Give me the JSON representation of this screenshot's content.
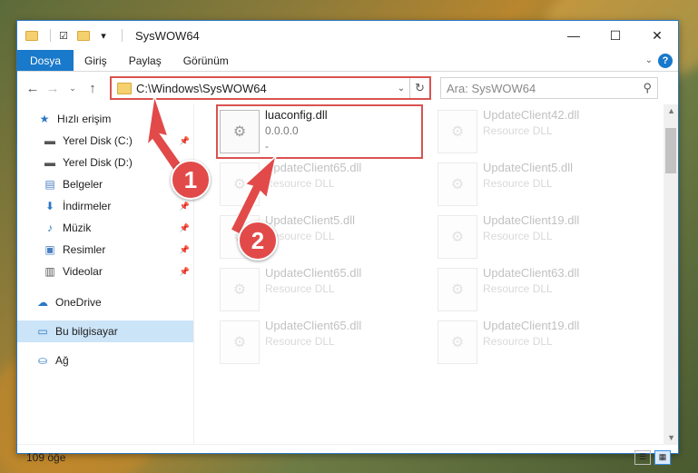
{
  "window": {
    "title": "SysWOW64"
  },
  "ribbon": {
    "tabs": [
      "Dosya",
      "Giriş",
      "Paylaş",
      "Görünüm"
    ]
  },
  "nav": {
    "address": "C:\\Windows\\SysWOW64",
    "search_placeholder": "Ara: SysWOW64"
  },
  "sidebar": {
    "items": [
      {
        "label": "Hızlı erişim",
        "icon": "star-icon"
      },
      {
        "label": "Yerel Disk (C:)",
        "icon": "drive-icon",
        "pinned": true
      },
      {
        "label": "Yerel Disk (D:)",
        "icon": "drive-icon"
      },
      {
        "label": "Belgeler",
        "icon": "documents-icon",
        "pinned": true
      },
      {
        "label": "İndirmeler",
        "icon": "download-icon",
        "pinned": true
      },
      {
        "label": "Müzik",
        "icon": "music-icon",
        "pinned": true
      },
      {
        "label": "Resimler",
        "icon": "pictures-icon",
        "pinned": true
      },
      {
        "label": "Videolar",
        "icon": "videos-icon",
        "pinned": true
      },
      {
        "label": "OneDrive",
        "icon": "cloud-icon"
      },
      {
        "label": "Bu bilgisayar",
        "icon": "computer-icon",
        "selected": true
      },
      {
        "label": "Ağ",
        "icon": "network-icon"
      }
    ]
  },
  "files": {
    "primary": {
      "name": "luaconfig.dll",
      "version": "0.0.0.0",
      "extra": "-"
    },
    "faded": [
      {
        "name": "UpdateClient42.dll",
        "type": "Resource DLL"
      },
      {
        "name": "UpdateClient65.dll",
        "type": "Resource DLL"
      },
      {
        "name": "UpdateClient5.dll",
        "type": "Resource DLL"
      },
      {
        "name": "UpdateClient5.dll",
        "type": "Resource DLL"
      },
      {
        "name": "UpdateClient19.dll",
        "type": "Resource DLL"
      },
      {
        "name": "UpdateClient65.dll",
        "type": "Resource DLL"
      },
      {
        "name": "UpdateClient63.dll",
        "type": "Resource DLL"
      },
      {
        "name": "UpdateClient65.dll",
        "type": "Resource DLL"
      },
      {
        "name": "UpdateClient19.dll",
        "type": "Resource DLL"
      }
    ]
  },
  "status": {
    "count": "109 öğe"
  },
  "callouts": {
    "one": "1",
    "two": "2"
  },
  "colors": {
    "accent": "#1979ca",
    "highlight": "#d9534f",
    "badge": "#e24a4a",
    "selected": "#cce4f7"
  }
}
